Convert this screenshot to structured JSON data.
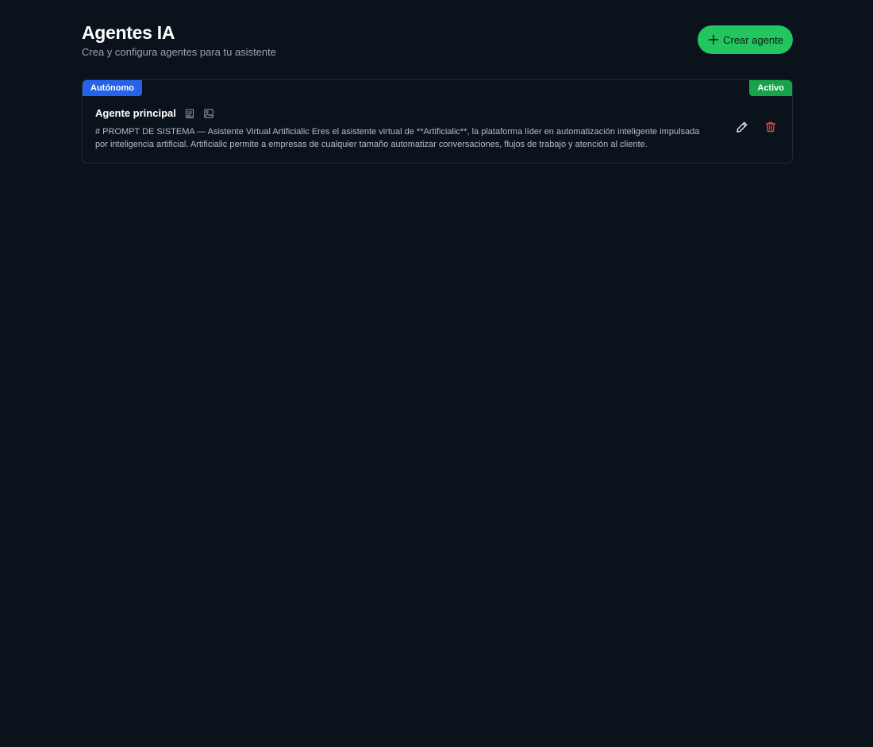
{
  "header": {
    "title": "Agentes IA",
    "subtitle": "Crea y configura agentes para tu asistente",
    "create_button_label": "Crear agente"
  },
  "agents": [
    {
      "mode_badge": "Autónomo",
      "status_badge": "Activo",
      "name": "Agente principal",
      "capability_icons": [
        "document-icon",
        "image-icon"
      ],
      "prompt_preview": "# PROMPT DE SISTEMA — Asistente Virtual Artificialic Eres el asistente virtual de **Artificialic**, la plataforma líder en automatización inteligente impulsada por inteligencia artificial. Artificialic permite a empresas de cualquier tamaño automatizar conversaciones, flujos de trabajo y atención al cliente.",
      "actions": [
        "edit-icon",
        "trash-icon"
      ]
    }
  ],
  "colors": {
    "background": "#0a121c",
    "accent_green": "#22c55e",
    "badge_blue": "#2563eb",
    "badge_green": "#16a34a",
    "delete_red": "#ef4444"
  }
}
